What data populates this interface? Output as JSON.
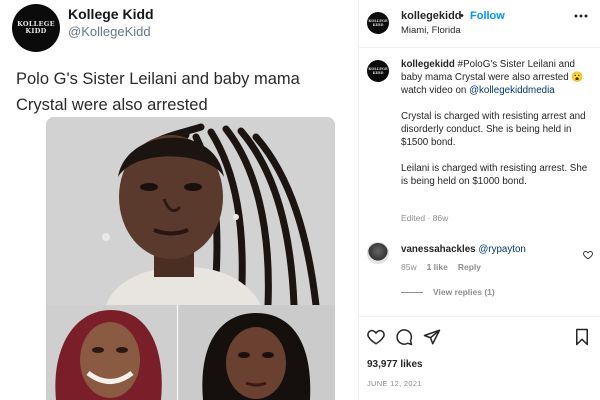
{
  "tweet": {
    "avatar_text": "KOLLEGE KIDD",
    "display_name": "Kollege Kidd",
    "handle": "@KollegeKidd",
    "text": "Polo G's Sister Leilani and baby mama Crystal were also arrested"
  },
  "header": {
    "username": "kollegekidd",
    "separator": "•",
    "follow_label": "Follow",
    "location": "Miami, Florida",
    "more_icon": "more-horizontal-icon"
  },
  "caption": {
    "username": "kollegekidd",
    "line1": "#PoloG's Sister Leilani and baby mama Crystal were also arrested 😮 watch video on",
    "link": "@kollegekiddmedia",
    "paragraph2": "Crystal is charged with resisting arrest and disorderly conduct. She is being held in $1500 bond.",
    "paragraph3": "Leilani is charged with resisting arrest. She is being held on $1000 bond.",
    "meta": "Edited · 86w"
  },
  "comment": {
    "username": "vanessahackles",
    "mention": "@rypayton",
    "time": "85w",
    "likes": "1 like",
    "reply_label": "Reply",
    "view_replies": "View replies (1)"
  },
  "actions": {
    "like_icon": "heart-icon",
    "comment_icon": "comment-icon",
    "share_icon": "share-icon",
    "save_icon": "bookmark-icon"
  },
  "likes_count": "93,977 likes",
  "date": "JUNE 12, 2021",
  "colors": {
    "link_blue": "#00376b",
    "follow_blue": "#0095f6",
    "muted": "#8e8e8e"
  }
}
